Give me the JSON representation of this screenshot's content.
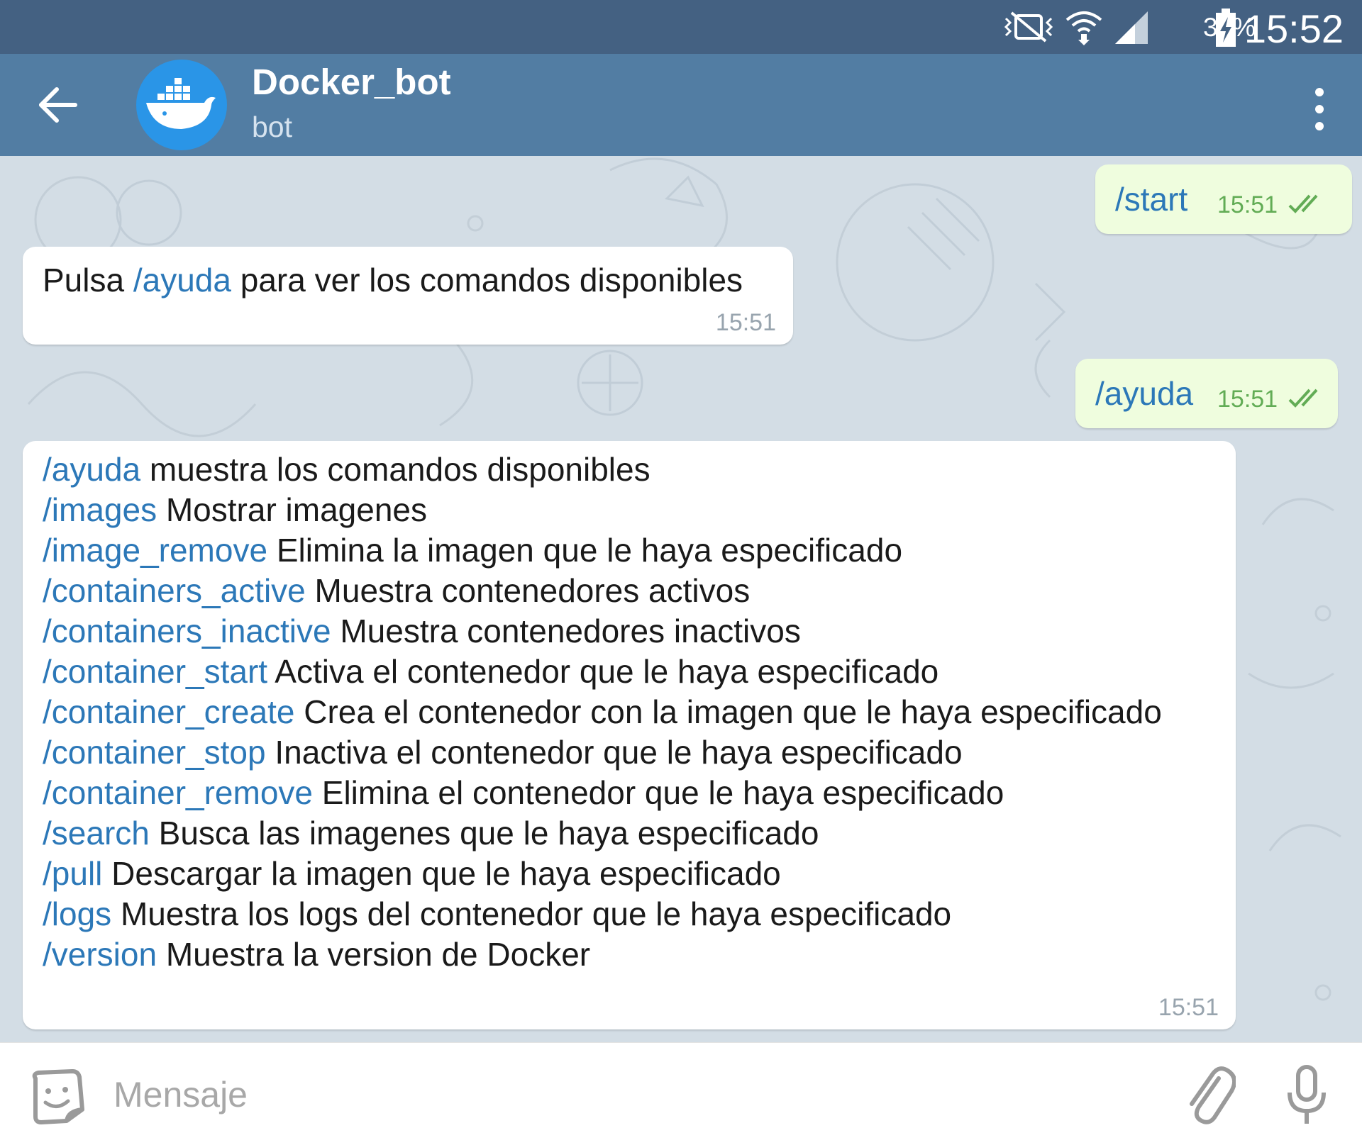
{
  "status_bar": {
    "battery": "37%",
    "time": "15:52",
    "icons": [
      "vibrate-mute-icon",
      "wifi-icon",
      "signal-icon",
      "battery-charging-icon"
    ]
  },
  "header": {
    "title": "Docker_bot",
    "subtitle": "bot",
    "avatar_icon": "docker-whale-icon",
    "back_icon": "arrow-back-icon",
    "menu_icon": "more-vert-icon"
  },
  "messages": [
    {
      "direction": "out",
      "text": "/start",
      "time": "15:51",
      "status": "read"
    },
    {
      "direction": "in",
      "prefix": "Pulsa ",
      "command": "/ayuda",
      "suffix": " para ver los comandos disponibles",
      "time": "15:51"
    },
    {
      "direction": "out",
      "text": "/ayuda",
      "time": "15:51",
      "status": "read"
    },
    {
      "direction": "in",
      "time": "15:51",
      "lines": [
        {
          "command": "/ayuda",
          "text": " muestra los comandos disponibles"
        },
        {
          "command": "/images",
          "text": " Mostrar imagenes"
        },
        {
          "command": "/image_remove",
          "text": " Elimina la imagen que le haya especificado"
        },
        {
          "command": "/containers_active",
          "text": " Muestra contenedores activos"
        },
        {
          "command": "/containers_inactive",
          "text": " Muestra contenedores inactivos"
        },
        {
          "command": "/container_start",
          "text": " Activa el contenedor que le haya especificado"
        },
        {
          "command": "/container_create",
          "text": " Crea el contenedor con la imagen que le haya especificado"
        },
        {
          "command": "/container_stop",
          "text": " Inactiva el contenedor que le haya especificado"
        },
        {
          "command": "/container_remove",
          "text": " Elimina el contenedor que le haya especificado"
        },
        {
          "command": "/search",
          "text": " Busca las imagenes que le haya especificado"
        },
        {
          "command": "/pull",
          "text": " Descargar la imagen que le haya especificado"
        },
        {
          "command": "/logs",
          "text": " Muestra los logs del contenedor que le haya especificado"
        },
        {
          "command": "/version",
          "text": " Muestra la version de Docker"
        }
      ]
    }
  ],
  "composer": {
    "placeholder": "Mensaje",
    "emoji_icon": "sticker-icon",
    "attach_icon": "paperclip-icon",
    "mic_icon": "microphone-icon"
  },
  "colors": {
    "status_bar": "#446182",
    "header": "#527da3",
    "chat_background": "#d3dde5",
    "outgoing_bubble": "#effdde",
    "incoming_bubble": "#ffffff",
    "command_link": "#2c78b8",
    "read_check": "#62ac55"
  }
}
